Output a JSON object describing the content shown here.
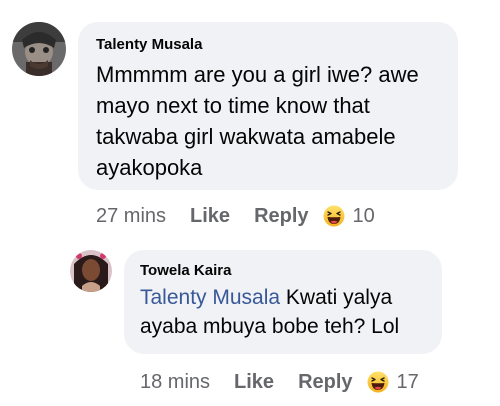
{
  "comments": [
    {
      "author": "Talenty Musala",
      "text_lines": [
        "Mmmmm are you a girl iwe? awe",
        "mayo next to time know that",
        "takwaba girl wakwata amabele",
        "ayakopoka"
      ],
      "time": "27 mins",
      "like_label": "Like",
      "reply_label": "Reply",
      "reaction_icon": "haha-emoji",
      "reaction_count": "10"
    },
    {
      "author": "Towela Kaira",
      "mention": "Talenty Musala",
      "text_line1_rest": " Kwati yalya",
      "text_line2": "ayaba mbuya bobe teh? Lol",
      "time": "18 mins",
      "like_label": "Like",
      "reply_label": "Reply",
      "reaction_icon": "haha-emoji",
      "reaction_count": "17"
    }
  ],
  "colors": {
    "bubble": "#f0f2f5",
    "mention": "#385898",
    "meta": "#65676b",
    "text": "#050505"
  }
}
